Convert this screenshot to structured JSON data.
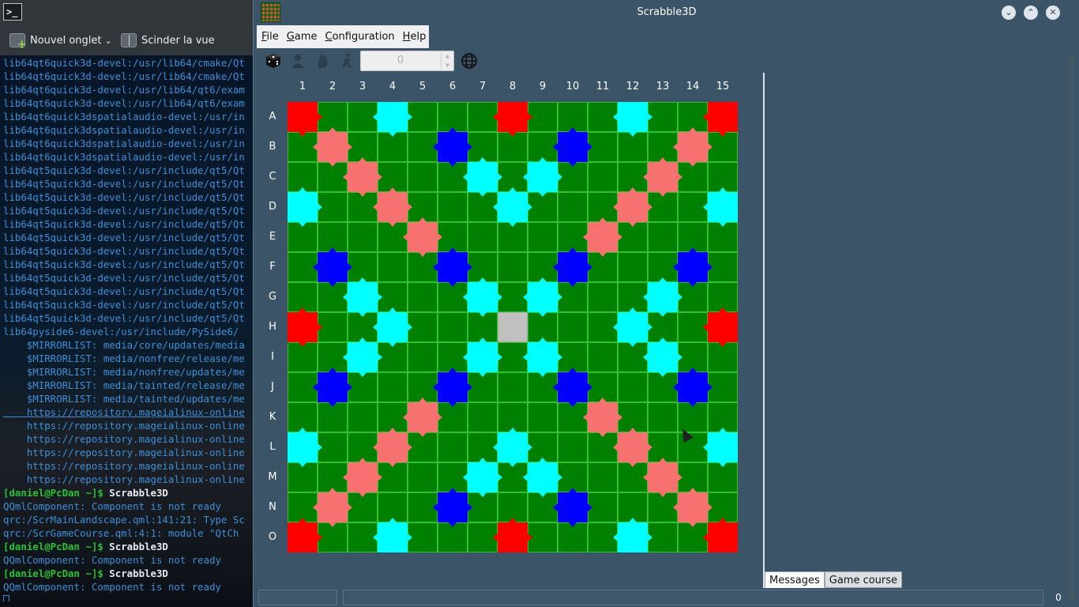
{
  "terminal": {
    "newtab_label": "Nouvel onglet",
    "split_label": "Scinder la vue",
    "lines": [
      {
        "t": "lib64qt6quick3d-devel:/usr/lib64/cmake/Qt",
        "c": "blue"
      },
      {
        "t": "lib64qt6quick3d-devel:/usr/lib64/cmake/Qt",
        "c": "blue"
      },
      {
        "t": "lib64qt6quick3d-devel:/usr/lib64/qt6/exam",
        "c": "blue"
      },
      {
        "t": "lib64qt6quick3d-devel:/usr/lib64/qt6/exam",
        "c": "blue"
      },
      {
        "t": "lib64qt6quick3dspatialaudio-devel:/usr/in",
        "c": "blue"
      },
      {
        "t": "lib64qt6quick3dspatialaudio-devel:/usr/in",
        "c": "blue"
      },
      {
        "t": "lib64qt6quick3dspatialaudio-devel:/usr/in",
        "c": "blue"
      },
      {
        "t": "lib64qt6quick3dspatialaudio-devel:/usr/in",
        "c": "blue"
      },
      {
        "t": "lib64qt5quick3d-devel:/usr/include/qt5/Qt",
        "c": "blue"
      },
      {
        "t": "lib64qt5quick3d-devel:/usr/include/qt5/Qt",
        "c": "blue"
      },
      {
        "t": "lib64qt5quick3d-devel:/usr/include/qt5/Qt",
        "c": "blue"
      },
      {
        "t": "lib64qt5quick3d-devel:/usr/include/qt5/Qt",
        "c": "blue"
      },
      {
        "t": "lib64qt5quick3d-devel:/usr/include/qt5/Qt",
        "c": "blue"
      },
      {
        "t": "lib64qt5quick3d-devel:/usr/include/qt5/Qt",
        "c": "blue"
      },
      {
        "t": "lib64qt5quick3d-devel:/usr/include/qt5/Qt",
        "c": "blue"
      },
      {
        "t": "lib64qt5quick3d-devel:/usr/include/qt5/Qt",
        "c": "blue"
      },
      {
        "t": "lib64qt5quick3d-devel:/usr/include/qt5/Qt",
        "c": "blue"
      },
      {
        "t": "lib64qt5quick3d-devel:/usr/include/qt5/Qt",
        "c": "blue"
      },
      {
        "t": "lib64qt5quick3d-devel:/usr/include/qt5/Qt",
        "c": "blue"
      },
      {
        "t": "lib64qt5quick3d-devel:/usr/include/qt5/Qt",
        "c": "blue"
      },
      {
        "t": "lib64pyside6-devel:/usr/include/PySide6/",
        "c": "blue"
      },
      {
        "t": "    $MIRRORLIST: media/core/updates/media",
        "c": "blue"
      },
      {
        "t": "    $MIRRORLIST: media/nonfree/release/me",
        "c": "blue"
      },
      {
        "t": "    $MIRRORLIST: media/nonfree/updates/me",
        "c": "blue"
      },
      {
        "t": "    $MIRRORLIST: media/tainted/release/me",
        "c": "blue"
      },
      {
        "t": "    $MIRRORLIST: media/tainted/updates/me",
        "c": "blue"
      },
      {
        "t": "    https://repository.mageialinux-online",
        "c": "blue ul"
      },
      {
        "t": "    https://repository.mageialinux-online",
        "c": "blue"
      },
      {
        "t": "    https://repository.mageialinux-online",
        "c": "blue"
      },
      {
        "t": "    https://repository.mageialinux-online",
        "c": "blue"
      },
      {
        "t": "    https://repository.mageialinux-online",
        "c": "blue"
      },
      {
        "t": "    https://repository.mageialinux-online",
        "c": "blue"
      },
      {
        "prompt": "[daniel@PcDan ~]$ ",
        "cmd": "Scrabble3D"
      },
      {
        "t": "QQmlComponent: Component is not ready",
        "c": "blue"
      },
      {
        "t": "qrc:/ScrMainLandscape.qml:141:21: Type Sc",
        "c": "blue"
      },
      {
        "t": "qrc:/ScrGameCourse.qml:4:1: module \"QtCh",
        "c": "blue"
      },
      {
        "prompt": "[daniel@PcDan ~]$ ",
        "cmd": "Scrabble3D"
      },
      {
        "t": "QQmlComponent: Component is not ready",
        "c": "blue"
      },
      {
        "prompt": "[daniel@PcDan ~]$ ",
        "cmd": "Scrabble3D"
      },
      {
        "t": "QQmlComponent: Component is not ready",
        "c": "blue"
      }
    ]
  },
  "window": {
    "title": "Scrabble3D",
    "app_icon": "scrabble-board-icon",
    "controls": [
      "minimize-icon",
      "maximize-icon",
      "close-icon"
    ]
  },
  "menubar": {
    "items": [
      "File",
      "Game",
      "Configuration",
      "Help"
    ]
  },
  "toolbar": {
    "icons": [
      "dice-icon",
      "player-icon",
      "hand-icon",
      "computer-player-icon",
      "globe-icon"
    ],
    "spin_value": "0"
  },
  "board": {
    "columns": [
      "1",
      "2",
      "3",
      "4",
      "5",
      "6",
      "7",
      "8",
      "9",
      "10",
      "11",
      "12",
      "13",
      "14",
      "15"
    ],
    "rows": [
      "A",
      "B",
      "C",
      "D",
      "E",
      "F",
      "G",
      "H",
      "I",
      "J",
      "K",
      "L",
      "M",
      "N",
      "O"
    ],
    "colors": {
      "board": "#008000",
      "grid": "#2fc32f",
      "triple_word": "#ff0000",
      "double_word": "#f87171",
      "triple_letter": "#0000ff",
      "double_letter": "#00ffff",
      "center": "#c0c0c0"
    },
    "triple_word": [
      [
        0,
        0
      ],
      [
        0,
        7
      ],
      [
        0,
        14
      ],
      [
        7,
        0
      ],
      [
        7,
        14
      ],
      [
        14,
        0
      ],
      [
        14,
        7
      ],
      [
        14,
        14
      ]
    ],
    "double_word": [
      [
        1,
        1
      ],
      [
        2,
        2
      ],
      [
        3,
        3
      ],
      [
        4,
        4
      ],
      [
        1,
        13
      ],
      [
        2,
        12
      ],
      [
        3,
        11
      ],
      [
        4,
        10
      ],
      [
        13,
        1
      ],
      [
        12,
        2
      ],
      [
        11,
        3
      ],
      [
        10,
        4
      ],
      [
        13,
        13
      ],
      [
        12,
        12
      ],
      [
        11,
        11
      ],
      [
        10,
        10
      ]
    ],
    "triple_letter": [
      [
        1,
        5
      ],
      [
        1,
        9
      ],
      [
        5,
        1
      ],
      [
        5,
        5
      ],
      [
        5,
        9
      ],
      [
        5,
        13
      ],
      [
        9,
        1
      ],
      [
        9,
        5
      ],
      [
        9,
        9
      ],
      [
        9,
        13
      ],
      [
        13,
        5
      ],
      [
        13,
        9
      ]
    ],
    "double_letter": [
      [
        0,
        3
      ],
      [
        0,
        11
      ],
      [
        2,
        6
      ],
      [
        2,
        8
      ],
      [
        3,
        0
      ],
      [
        3,
        7
      ],
      [
        3,
        14
      ],
      [
        6,
        2
      ],
      [
        6,
        6
      ],
      [
        6,
        8
      ],
      [
        6,
        12
      ],
      [
        7,
        3
      ],
      [
        7,
        11
      ],
      [
        8,
        2
      ],
      [
        8,
        6
      ],
      [
        8,
        8
      ],
      [
        8,
        12
      ],
      [
        11,
        0
      ],
      [
        11,
        7
      ],
      [
        11,
        14
      ],
      [
        12,
        6
      ],
      [
        12,
        8
      ],
      [
        14,
        3
      ],
      [
        14,
        11
      ]
    ],
    "center": [
      7,
      7
    ]
  },
  "tabs": [
    "Messages",
    "Game course"
  ],
  "statusbar": {
    "count": "0"
  }
}
